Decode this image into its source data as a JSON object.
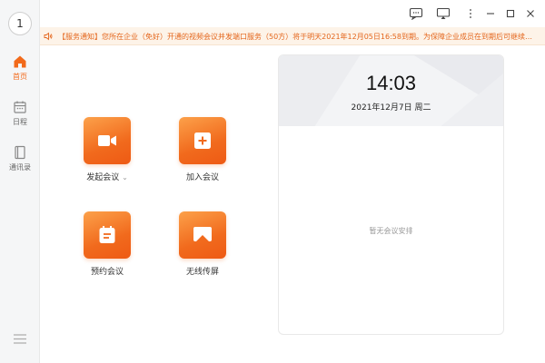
{
  "sidebar": {
    "avatar_text": "1",
    "items": [
      {
        "label": "首页",
        "icon": "home-icon",
        "active": true
      },
      {
        "label": "日程",
        "icon": "calendar-icon",
        "active": false
      },
      {
        "label": "通讯录",
        "icon": "contacts-icon",
        "active": false
      }
    ],
    "menu_icon": "hamburger-menu-icon"
  },
  "titlebar": {
    "buttons": [
      "message-icon",
      "screen-cast-icon",
      "more-icon",
      "minimize-icon",
      "maximize-icon",
      "close-icon"
    ]
  },
  "notice": {
    "text": "【服务通知】您所在企业（免好）开通的视频会议并发端口服务（50方）将于明天2021年12月05日16:58到期。为保障企业成员在到期后可继续正常使用..."
  },
  "actions": [
    {
      "label": "发起会议",
      "icon": "video-camera-icon",
      "has_dropdown": true
    },
    {
      "label": "加入会议",
      "icon": "plus-icon",
      "has_dropdown": false
    },
    {
      "label": "预约会议",
      "icon": "calendar-schedule-icon",
      "has_dropdown": false
    },
    {
      "label": "无线传屏",
      "icon": "screen-share-icon",
      "has_dropdown": false
    }
  ],
  "schedule": {
    "time": "14:03",
    "date": "2021年12月7日 周二",
    "empty_text": "暂无会议安排"
  },
  "colors": {
    "accent": "#f26a1b",
    "notice_bg": "#fdf3e8",
    "sidebar_bg": "#f5f6f7"
  }
}
